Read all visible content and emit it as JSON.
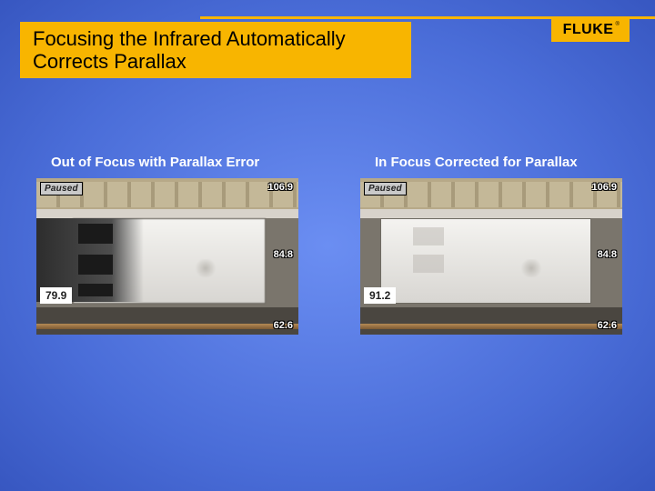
{
  "brand": "FLUKE",
  "title": "Focusing the Infrared Automatically Corrects Parallax",
  "captions": {
    "left": "Out of Focus with Parallax Error",
    "right": "In Focus Corrected for Parallax"
  },
  "panels": {
    "left": {
      "status": "Paused",
      "main_temp": "79.9",
      "scale_high": "106.9",
      "scale_mid": "84.8",
      "scale_low": "62.6"
    },
    "right": {
      "status": "Paused",
      "main_temp": "91.2",
      "scale_high": "106.9",
      "scale_mid": "84.8",
      "scale_low": "62.6"
    }
  }
}
